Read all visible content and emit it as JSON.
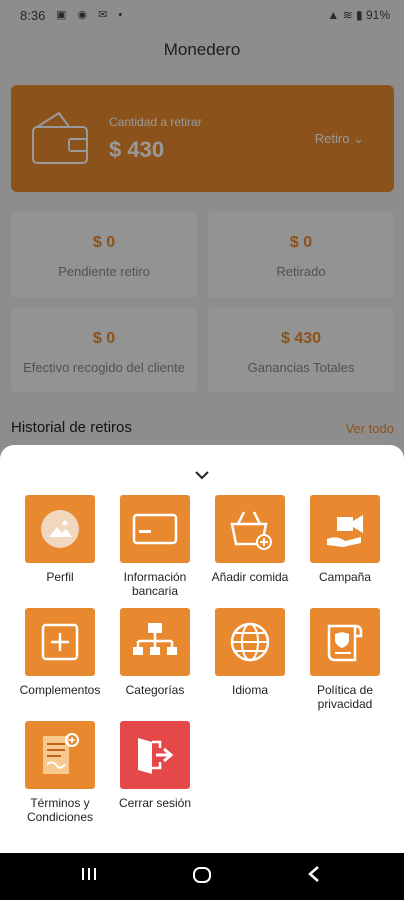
{
  "status_bar": {
    "time": "8:36",
    "battery": "91%"
  },
  "header": {
    "title": "Monedero"
  },
  "wallet": {
    "label": "Cantidad a retirar",
    "amount": "$ 430",
    "dropdown": "Retiro"
  },
  "stats": [
    {
      "value": "$ 0",
      "label": "Pendiente retiro"
    },
    {
      "value": "$ 0",
      "label": "Retirado"
    },
    {
      "value": "$ 0",
      "label": "Efectivo recogido del cliente"
    },
    {
      "value": "$ 430",
      "label": "Ganancias Totales"
    }
  ],
  "history": {
    "title": "Historial de retiros",
    "see_all": "Ver todo"
  },
  "menu": [
    {
      "label": "Perfil",
      "icon": "image-icon"
    },
    {
      "label": "Información bancaria",
      "icon": "card-icon"
    },
    {
      "label": "Añadir comida",
      "icon": "basket-icon"
    },
    {
      "label": "Campaña",
      "icon": "campaign-icon"
    },
    {
      "label": "Complementos",
      "icon": "plus-square-icon"
    },
    {
      "label": "Categorías",
      "icon": "hierarchy-icon"
    },
    {
      "label": "Idioma",
      "icon": "globe-icon"
    },
    {
      "label": "Política de privacidad",
      "icon": "privacy-document-icon"
    },
    {
      "label": "Términos y Condiciones",
      "icon": "terms-document-icon"
    },
    {
      "label": "Cerrar sesión",
      "icon": "logout-icon"
    }
  ],
  "colors": {
    "accent": "#e8892f",
    "logout": "#e54848"
  }
}
